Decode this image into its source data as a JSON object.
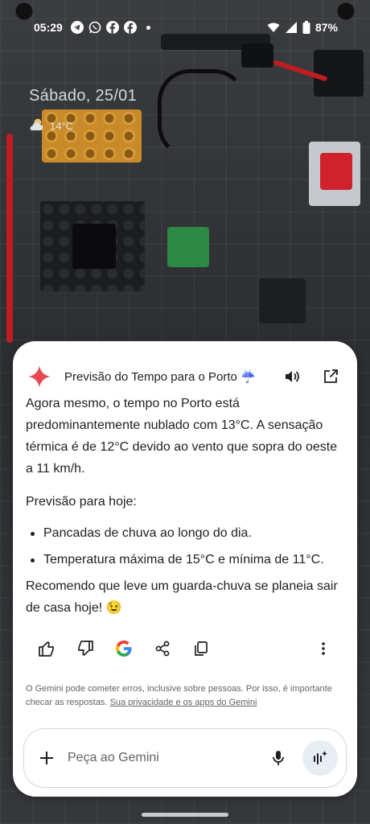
{
  "status_bar": {
    "time": "05:29",
    "battery": "87%",
    "icons": [
      "telegram-icon",
      "whatsapp-icon",
      "facebook-icon",
      "facebook-icon",
      "wifi-icon",
      "signal-icon",
      "battery-icon"
    ]
  },
  "lockscreen": {
    "date": "Sábado, 25/01",
    "temperature": "14°C",
    "weather_icon": "partly-cloudy-icon"
  },
  "gemini_card": {
    "title": "Previsão do Tempo para o Porto ☔",
    "paragraph1": "Agora mesmo, o tempo no Porto está predominantemente nublado com 13°C. A sensação térmica é de 12°C devido ao vento que sopra do oeste a 11 km/h.",
    "forecast_heading": "Previsão para hoje:",
    "bullets": [
      "Pancadas de chuva ao longo do dia.",
      "Temperatura máxima de 15°C e mínima de 11°C."
    ],
    "recommendation": "Recomendo que leve um guarda-chuva se planeia sair de casa hoje! 😉",
    "disclaimer_text": "O Gemini pode cometer erros, inclusive sobre pessoas. Por isso, é importante checar as respostas. ",
    "disclaimer_link": "Sua privacidade e os apps do Gemini",
    "input_placeholder": "Peça ao Gemini"
  },
  "colors": {
    "card_background": "#ffffff",
    "spark_red": "#e8484f",
    "google_blue": "#4285f4",
    "google_red": "#ea4335",
    "google_yellow": "#fbbc05",
    "google_green": "#34a853"
  }
}
